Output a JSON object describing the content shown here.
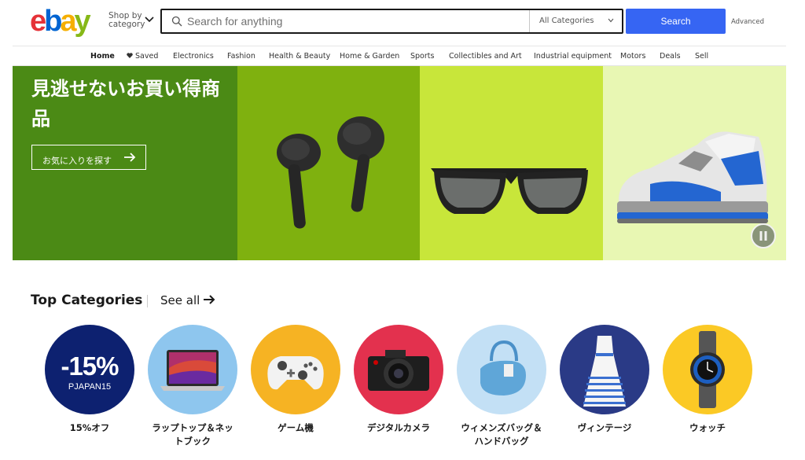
{
  "header": {
    "shop_by_line1": "Shop by",
    "shop_by_line2": "category",
    "search_placeholder": "Search for anything",
    "category_selected": "All Categories",
    "search_button": "Search",
    "advanced_link": "Advanced"
  },
  "nav": {
    "items": [
      "Home",
      "Saved",
      "Electronics",
      "Fashion",
      "Health & Beauty",
      "Home & Garden",
      "Sports",
      "Collectibles and Art",
      "Industrial equipment",
      "Motors",
      "Deals",
      "Sell"
    ]
  },
  "banner": {
    "title": "見逃せないお買い得商品",
    "cta": "お気に入りを探す"
  },
  "top_categories": {
    "title": "Top Categories",
    "see_all": "See all",
    "promo_big": "-15%",
    "promo_code": "PJAPAN15",
    "items": [
      {
        "label": "15%オフ",
        "icon": "discount-badge",
        "color": "#0d2170"
      },
      {
        "label": "ラップトップ＆ネットブック",
        "icon": "laptop-image",
        "color": "#8ec6ee"
      },
      {
        "label": "ゲーム機",
        "icon": "game-controller-image",
        "color": "#f6b323"
      },
      {
        "label": "デジタルカメラ",
        "icon": "camera-image",
        "color": "#e3314e"
      },
      {
        "label": "ウィメンズバッグ＆ハンドバッグ",
        "icon": "handbag-image",
        "color": "#c3e0f5"
      },
      {
        "label": "ヴィンテージ",
        "icon": "dress-image",
        "color": "#2a3a86"
      },
      {
        "label": "ウォッチ",
        "icon": "watch-image",
        "color": "#fbc925"
      }
    ]
  },
  "colors": {
    "accent_blue": "#3665f3",
    "logo_red": "#e53238",
    "logo_blue": "#0064d2",
    "logo_yellow": "#f5af02",
    "logo_green": "#86b817"
  }
}
